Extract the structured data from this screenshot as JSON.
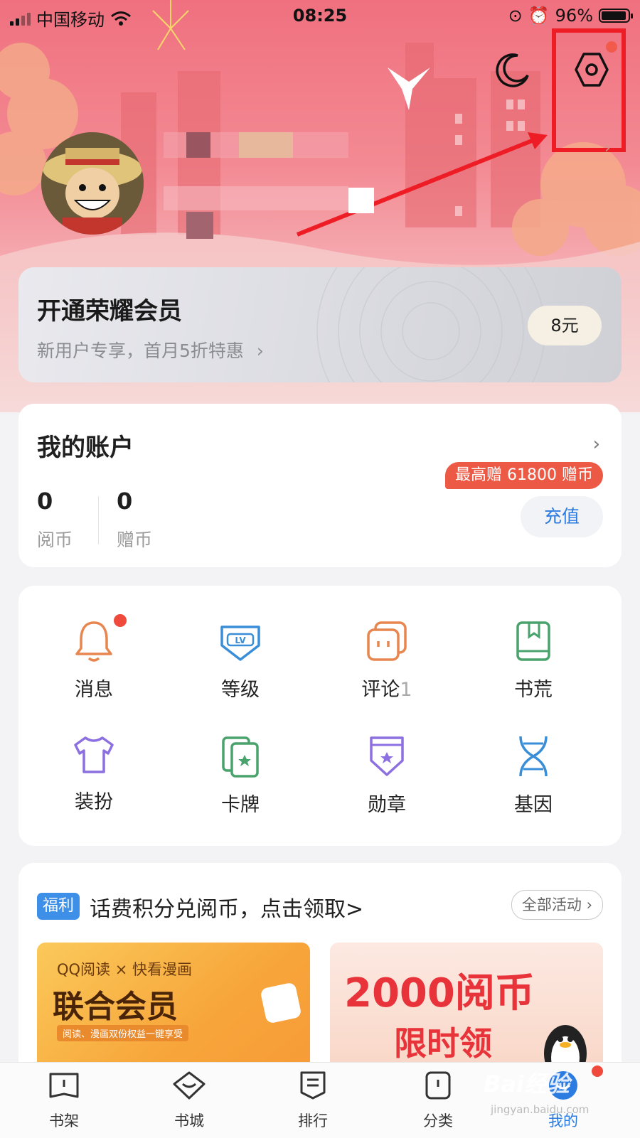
{
  "status_bar": {
    "carrier": "中国移动",
    "time": "08:25",
    "battery": "96%"
  },
  "vip": {
    "title": "开通荣耀会员",
    "subtitle": "新用户专享，首月5折特惠",
    "price": "8元"
  },
  "account": {
    "title": "我的账户",
    "read_coins": "0",
    "read_coins_label": "阅币",
    "gift_coins": "0",
    "gift_coins_label": "赠币",
    "promo": "最高赠 61800 赠币",
    "recharge": "充值"
  },
  "grid": [
    {
      "label": "消息",
      "icon": "bell-icon",
      "badge": true
    },
    {
      "label": "等级",
      "icon": "level-icon"
    },
    {
      "label": "评论",
      "icon": "comment-icon",
      "count": "1"
    },
    {
      "label": "书荒",
      "icon": "book-icon"
    },
    {
      "label": "装扮",
      "icon": "shirt-icon"
    },
    {
      "label": "卡牌",
      "icon": "card-icon"
    },
    {
      "label": "勋章",
      "icon": "medal-icon"
    },
    {
      "label": "基因",
      "icon": "dna-icon"
    }
  ],
  "welfare": {
    "tag": "福利",
    "title": "话费积分兑阅币，点击领取>",
    "all": "全部活动",
    "banner1": {
      "line1": "QQ阅读 × 快看漫画",
      "line2": "联合会员",
      "line3": "阅读、漫画双份权益一键享受"
    },
    "banner2": {
      "line1": "2000阅币",
      "line2": "限时领"
    }
  },
  "tabs": [
    {
      "label": "书架",
      "icon": "bookshelf-icon"
    },
    {
      "label": "书城",
      "icon": "bookstore-icon"
    },
    {
      "label": "排行",
      "icon": "ranking-icon"
    },
    {
      "label": "分类",
      "icon": "category-icon"
    },
    {
      "label": "我的",
      "icon": "profile-icon",
      "active": true
    }
  ],
  "watermark": {
    "text": "Bai经验",
    "url": "jingyan.baidu.com"
  },
  "colors": {
    "accent": "#2b7be0",
    "highlight": "#ee1c25",
    "promo": "#ec5a46"
  }
}
